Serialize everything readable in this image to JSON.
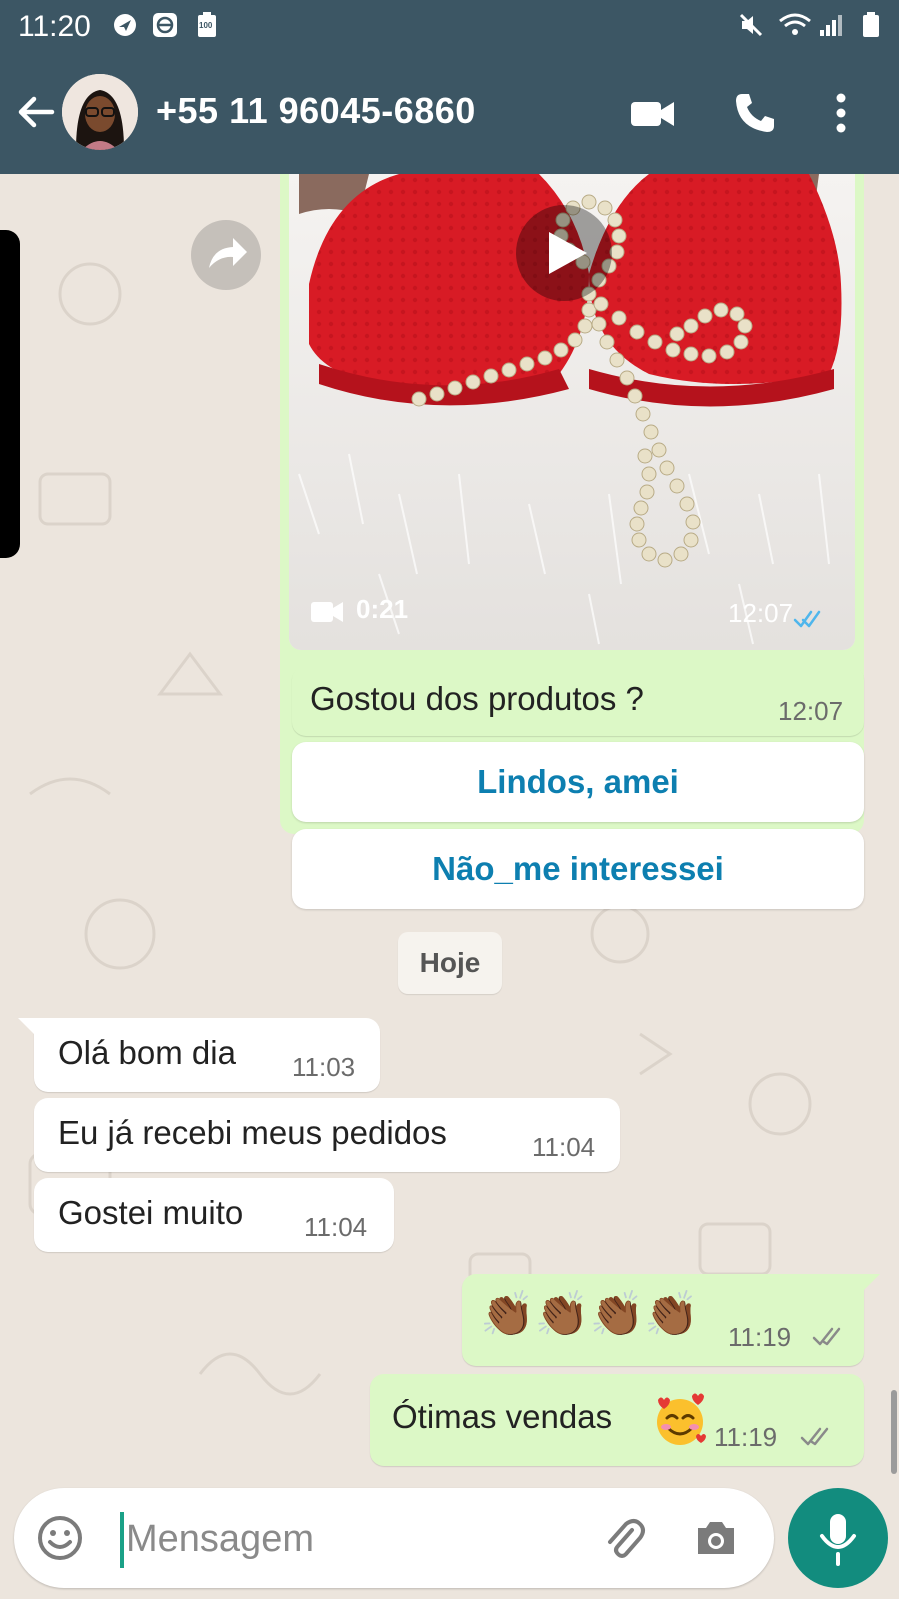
{
  "status_bar": {
    "time": "11:20",
    "battery_label": "100"
  },
  "header": {
    "contact": "+55 11 96045-6860",
    "icons": [
      "back-arrow-icon",
      "avatar",
      "video-call-icon",
      "phone-icon",
      "more-vert-icon"
    ]
  },
  "media_message": {
    "video_duration": "0:21",
    "time": "12:07",
    "status": "read"
  },
  "messages": [
    {
      "dir": "out",
      "text": "Gostou dos produtos ?",
      "time": "12:07"
    },
    {
      "dir": "in",
      "text": "Olá bom dia",
      "time": "11:03"
    },
    {
      "dir": "in",
      "text": "Eu já recebi meus pedidos",
      "time": "11:04"
    },
    {
      "dir": "in",
      "text": "Gostei muito",
      "time": "11:04"
    },
    {
      "dir": "out",
      "text": "👏🏾👏🏾👏🏾👏🏾",
      "time": "11:19",
      "status": "delivered"
    },
    {
      "dir": "out",
      "text": "Ótimas vendas",
      "time": "11:19",
      "status": "delivered"
    }
  ],
  "quick_replies": [
    "Lindos, amei",
    "Não_me interessei"
  ],
  "date_divider": "Hoje",
  "composer": {
    "placeholder": "Mensagem"
  },
  "colors": {
    "header": "#3c5664",
    "chat_bg": "#ece5dd",
    "outgoing": "#dcf8c6",
    "incoming": "#ffffff",
    "accent": "#128c7e",
    "quick_reply_text": "#0d7fb0",
    "read_tick": "#4fb6ec"
  }
}
